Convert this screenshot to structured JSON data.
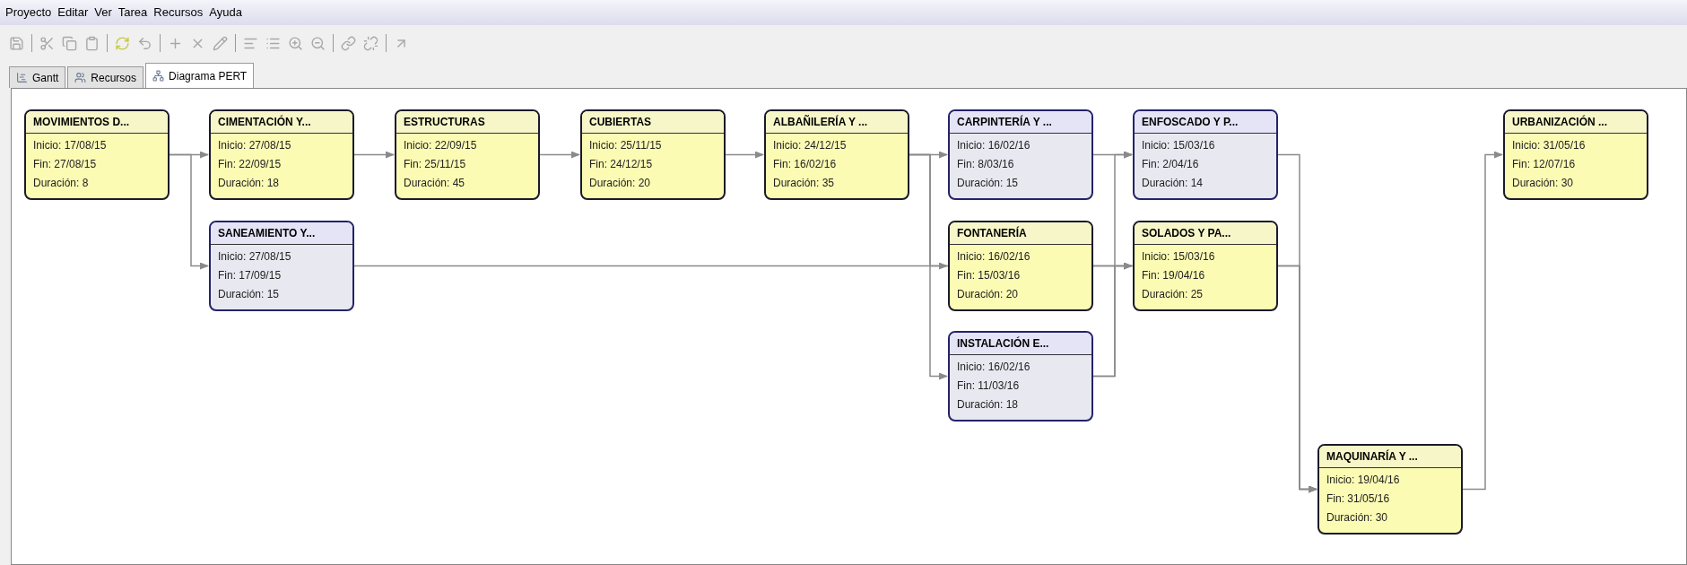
{
  "menu": [
    "Proyecto",
    "Editar",
    "Ver",
    "Tarea",
    "Recursos",
    "Ayuda"
  ],
  "tabs": [
    {
      "label": "Gantt",
      "selected": false
    },
    {
      "label": "Recursos",
      "selected": false
    },
    {
      "label": "Diagrama PERT",
      "selected": true
    }
  ],
  "tasks": [
    {
      "name": "MOVIMIENTOS D...",
      "start": "Inicio: 17/08/15",
      "end": "Fin: 27/08/15",
      "duration": "Duración: 8",
      "critical": true
    },
    {
      "name": "CIMENTACIÓN Y...",
      "start": "Inicio: 27/08/15",
      "end": "Fin: 22/09/15",
      "duration": "Duración: 18",
      "critical": true
    },
    {
      "name": "SANEAMIENTO Y...",
      "start": "Inicio: 27/08/15",
      "end": "Fin: 17/09/15",
      "duration": "Duración: 15",
      "critical": false
    },
    {
      "name": "ESTRUCTURAS",
      "start": "Inicio: 22/09/15",
      "end": "Fin: 25/11/15",
      "duration": "Duración: 45",
      "critical": true
    },
    {
      "name": "CUBIERTAS",
      "start": "Inicio: 25/11/15",
      "end": "Fin: 24/12/15",
      "duration": "Duración: 20",
      "critical": true
    },
    {
      "name": "ALBAÑILERÍA Y ...",
      "start": "Inicio: 24/12/15",
      "end": "Fin: 16/02/16",
      "duration": "Duración: 35",
      "critical": true
    },
    {
      "name": "CARPINTERÍA Y ...",
      "start": "Inicio: 16/02/16",
      "end": "Fin: 8/03/16",
      "duration": "Duración: 15",
      "critical": false
    },
    {
      "name": "FONTANERÍA",
      "start": "Inicio: 16/02/16",
      "end": "Fin: 15/03/16",
      "duration": "Duración: 20",
      "critical": true
    },
    {
      "name": "INSTALACIÓN E...",
      "start": "Inicio: 16/02/16",
      "end": "Fin: 11/03/16",
      "duration": "Duración: 18",
      "critical": false
    },
    {
      "name": "ENFOSCADO Y P...",
      "start": "Inicio: 15/03/16",
      "end": "Fin: 2/04/16",
      "duration": "Duración: 14",
      "critical": false
    },
    {
      "name": "SOLADOS Y PA...",
      "start": "Inicio: 15/03/16",
      "end": "Fin: 19/04/16",
      "duration": "Duración: 25",
      "critical": true
    },
    {
      "name": "MAQUINARÍA Y ...",
      "start": "Inicio: 19/04/16",
      "end": "Fin: 31/05/16",
      "duration": "Duración: 30",
      "critical": true
    },
    {
      "name": "URBANIZACIÓN ...",
      "start": "Inicio: 31/05/16",
      "end": "Fin: 12/07/16",
      "duration": "Duración: 30",
      "critical": true
    }
  ]
}
